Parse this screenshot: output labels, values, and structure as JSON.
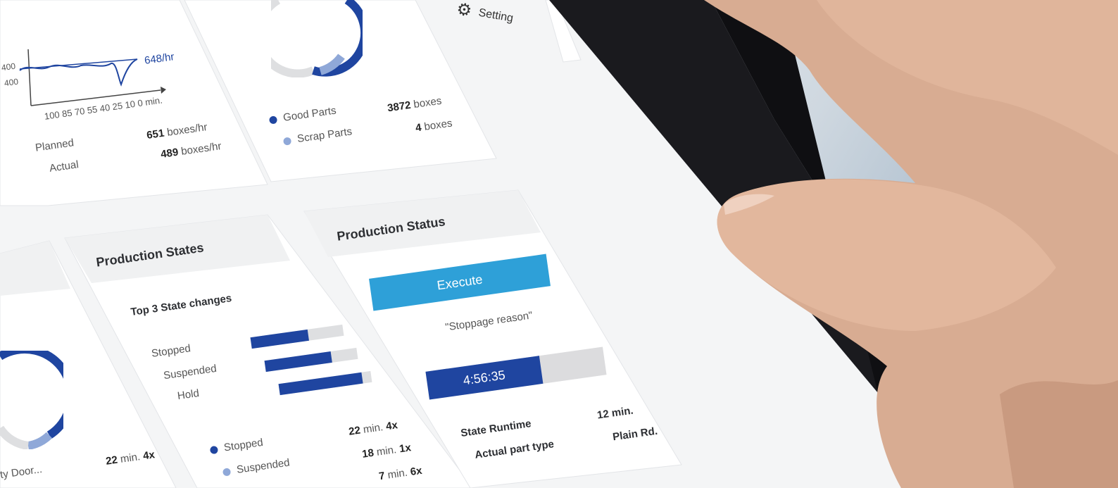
{
  "colors": {
    "accent": "#1f45a0",
    "accent_light": "#8fa8d8",
    "execute": "#2ea0d8",
    "track": "#dedfe1"
  },
  "header": {
    "setting_label": "Setting",
    "setting_icon": "gear-icon"
  },
  "rate_card": {
    "series_label": "648/hr",
    "y_ticks": [
      "400",
      "400"
    ],
    "x_ticks": "100 85 70 55 40 25 10 0 min.",
    "rows": [
      {
        "label": "Planned",
        "value": "651",
        "unit": "boxes/hr"
      },
      {
        "label": "Actual",
        "value": "489",
        "unit": "boxes/hr"
      }
    ]
  },
  "parts_card": {
    "donut_good_fraction": 0.98,
    "rows": [
      {
        "label": "Good Parts",
        "value": "3872",
        "unit": "boxes"
      },
      {
        "label": "Scrap Parts",
        "value": "4",
        "unit": "boxes"
      }
    ]
  },
  "states_card": {
    "title": "Production States",
    "subtitle": "Top 3 State changes",
    "bars": [
      {
        "label": "Stopped",
        "fraction": 0.62
      },
      {
        "label": "Suspended",
        "fraction": 0.72
      },
      {
        "label": "Hold",
        "fraction": 0.9
      }
    ],
    "legend": [
      {
        "label": "Stopped",
        "value": "22",
        "unit": "min.",
        "count": "4x"
      },
      {
        "label": "Suspended",
        "value": "18",
        "unit": "min.",
        "count": "1x"
      },
      {
        "label": "",
        "value": "7",
        "unit": "min.",
        "count": "6x"
      }
    ]
  },
  "status_card": {
    "title": "Production Status",
    "execute_label": "Execute",
    "stoppage_reason": "\"Stoppage reason\"",
    "timer": "4:56:35",
    "timer_fraction": 0.64,
    "rows": [
      {
        "label": "State Runtime",
        "value": "12 min."
      },
      {
        "label": "Actual part type",
        "value": "Plain Rd."
      }
    ]
  },
  "left_card": {
    "partial_label": "ty Door...",
    "value": "22",
    "unit": "min.",
    "count": "4x"
  }
}
